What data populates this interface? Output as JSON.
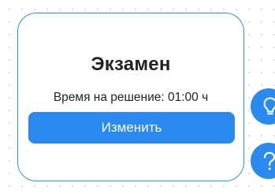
{
  "card": {
    "title": "Экзамен",
    "time_label": "Время на решение: 01:00 ч",
    "edit_button": "Изменить"
  },
  "fabs": {
    "hint_icon": "lightbulb-icon",
    "help_icon": "question-mark-icon"
  },
  "colors": {
    "accent": "#2a8af0",
    "card_border": "#2f8fe8",
    "text": "#1f2328",
    "background_dot": "#d4d7dd"
  }
}
